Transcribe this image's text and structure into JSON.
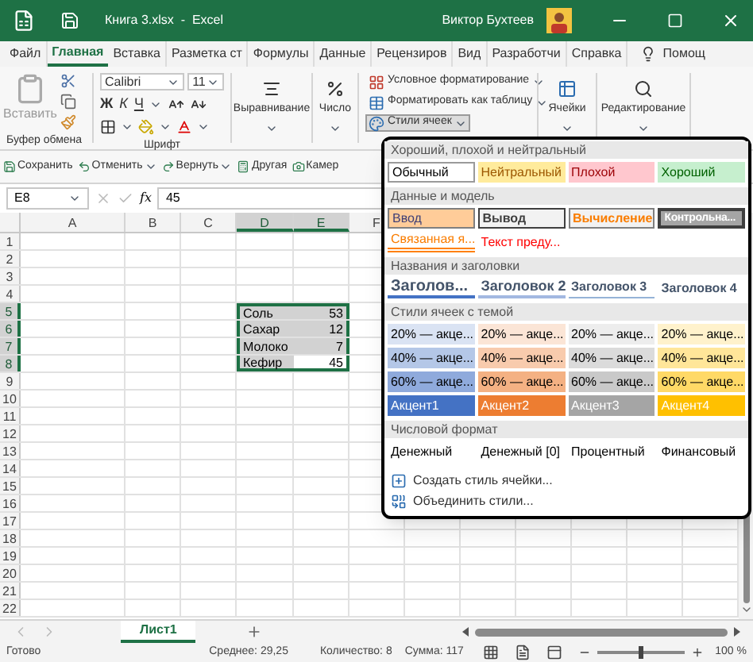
{
  "window": {
    "title": "Книга 3.xlsx  -  Excel",
    "user": "Виктор Бухтеев"
  },
  "tabs": [
    {
      "label": "Файл",
      "selected": false
    },
    {
      "label": "Главная",
      "selected": true
    },
    {
      "label": "Вставка",
      "selected": false
    },
    {
      "label": "Разметка ст",
      "selected": false
    },
    {
      "label": "Формулы",
      "selected": false
    },
    {
      "label": "Данные",
      "selected": false
    },
    {
      "label": "Рецензиров",
      "selected": false
    },
    {
      "label": "Вид",
      "selected": false
    },
    {
      "label": "Разработчи",
      "selected": false
    },
    {
      "label": "Справка",
      "selected": false
    }
  ],
  "help": "Помощ",
  "ribbon": {
    "paste": "Вставить",
    "clipboard_label": "Буфер обмена",
    "font_name": "Calibri",
    "font_size": "11",
    "bold": "Ж",
    "italic": "К",
    "underline": "Ч",
    "font_label": "Шрифт",
    "alignment": "Выравнивание",
    "number": "Число",
    "styles": [
      {
        "label": "Условное форматирование",
        "expanded": false
      },
      {
        "label": "Форматировать как таблицу",
        "expanded": false
      },
      {
        "label": "Стили ячеек",
        "expanded": true
      }
    ],
    "cells": "Ячейки",
    "editing": "Редактирование"
  },
  "quick_access": [
    "Сохранить",
    "Отменить",
    "Вернуть",
    "Другая",
    "Камер"
  ],
  "formula_bar": {
    "name_box": "E8",
    "fx": "fx",
    "value": "45"
  },
  "sheet": {
    "columns": [
      {
        "label": "A",
        "selected": false
      },
      {
        "label": "B",
        "selected": false
      },
      {
        "label": "C",
        "selected": false
      },
      {
        "label": "D",
        "selected": true
      },
      {
        "label": "E",
        "selected": true
      },
      {
        "label": "F",
        "selected": false
      }
    ],
    "rows": [
      {
        "number": "1",
        "selected": false
      },
      {
        "number": "2",
        "selected": false
      },
      {
        "number": "3",
        "selected": false
      },
      {
        "number": "4",
        "selected": false
      },
      {
        "number": "5",
        "selected": true,
        "cells": [
          {
            "text": "Соль",
            "active": false
          },
          {
            "text": "53",
            "active": false
          }
        ]
      },
      {
        "number": "6",
        "selected": true,
        "cells": [
          {
            "text": "Сахар",
            "active": false
          },
          {
            "text": "12",
            "active": false
          }
        ]
      },
      {
        "number": "7",
        "selected": true,
        "cells": [
          {
            "text": "Молоко",
            "active": false
          },
          {
            "text": "7",
            "active": false
          }
        ]
      },
      {
        "number": "8",
        "selected": true,
        "cells": [
          {
            "text": "Кефир",
            "active": false
          },
          {
            "text": "45",
            "active": true
          }
        ]
      },
      {
        "number": "9",
        "selected": false
      },
      {
        "number": "10",
        "selected": false
      },
      {
        "number": "11",
        "selected": false
      },
      {
        "number": "12",
        "selected": false
      },
      {
        "number": "13",
        "selected": false
      },
      {
        "number": "14",
        "selected": false
      },
      {
        "number": "15",
        "selected": false
      },
      {
        "number": "16",
        "selected": false
      },
      {
        "number": "17",
        "selected": false
      },
      {
        "number": "18",
        "selected": false
      },
      {
        "number": "19",
        "selected": false
      },
      {
        "number": "20",
        "selected": false
      },
      {
        "number": "21",
        "selected": false
      },
      {
        "number": "22",
        "selected": false
      }
    ]
  },
  "sheet_tabs": [
    {
      "label": "Лист1",
      "selected": true
    }
  ],
  "status_bar": {
    "state": "Готово",
    "average": "Среднее: 29,25",
    "count": "Количество: 8",
    "sum": "Сумма: 117",
    "zoom": {
      "label": "100 %",
      "level": 0.5
    }
  },
  "cell_styles_menu": {
    "sections": [
      {
        "title": "Хороший, плохой и нейтральный",
        "items": [
          {
            "label": "Обычный",
            "kind": "normal"
          },
          {
            "label": "Нейтральный",
            "kind": "neutral"
          },
          {
            "label": "Плохой",
            "kind": "bad"
          },
          {
            "label": "Хороший",
            "kind": "good"
          }
        ]
      },
      {
        "title": "Данные и модель",
        "items": [
          {
            "label": "Ввод",
            "kind": "input"
          },
          {
            "label": "Вывод",
            "kind": "output"
          },
          {
            "label": "Вычисление",
            "kind": "calc"
          },
          {
            "label": "Контрольна...",
            "kind": "check"
          },
          {
            "label": "Связанная я...",
            "kind": "linked"
          },
          {
            "label": "Текст преду...",
            "kind": "warning"
          }
        ]
      },
      {
        "title": "Названия и заголовки",
        "items": [
          {
            "label": "Заголов...",
            "kind": "h1"
          },
          {
            "label": "Заголовок 2",
            "kind": "h2"
          },
          {
            "label": "Заголовок 3",
            "kind": "h3"
          },
          {
            "label": "Заголовок 4",
            "kind": "h4"
          }
        ]
      },
      {
        "title": "Стили ячеек с темой",
        "items": [
          {
            "label": "20% — акце...",
            "kind": "tint",
            "color": "#dae3f3"
          },
          {
            "label": "20% — акце...",
            "kind": "tint",
            "color": "#fbe5d6"
          },
          {
            "label": "20% — акце...",
            "kind": "tint",
            "color": "#ededed"
          },
          {
            "label": "20% — акце...",
            "kind": "tint",
            "color": "#fff2cc"
          },
          {
            "label": "40% — акце...",
            "kind": "tint",
            "color": "#b4c7e7"
          },
          {
            "label": "40% — акце...",
            "kind": "tint",
            "color": "#f8cbad"
          },
          {
            "label": "40% — акце...",
            "kind": "tint",
            "color": "#dbdbdb"
          },
          {
            "label": "40% — акце...",
            "kind": "tint",
            "color": "#ffe699"
          },
          {
            "label": "60% — акце...",
            "kind": "tint",
            "color": "#8faadc"
          },
          {
            "label": "60% — акце...",
            "kind": "tint",
            "color": "#f4b183"
          },
          {
            "label": "60% — акце...",
            "kind": "tint",
            "color": "#c9c9c9"
          },
          {
            "label": "60% — акце...",
            "kind": "tint",
            "color": "#ffd966"
          },
          {
            "label": "Акцент1",
            "kind": "accent",
            "color": "#4472c4"
          },
          {
            "label": "Акцент2",
            "kind": "accent",
            "color": "#ed7d31"
          },
          {
            "label": "Акцент3",
            "kind": "accent",
            "color": "#a5a5a5"
          },
          {
            "label": "Акцент4",
            "kind": "accent",
            "color": "#ffc000"
          }
        ]
      },
      {
        "title": "Числовой формат",
        "items": [
          {
            "label": "Денежный",
            "kind": "plain"
          },
          {
            "label": "Денежный [0]",
            "kind": "plain"
          },
          {
            "label": "Процентный",
            "kind": "plain"
          },
          {
            "label": "Финансовый",
            "kind": "plain"
          }
        ]
      }
    ],
    "actions": [
      "Создать стиль ячейки...",
      "Объединить стили..."
    ]
  }
}
